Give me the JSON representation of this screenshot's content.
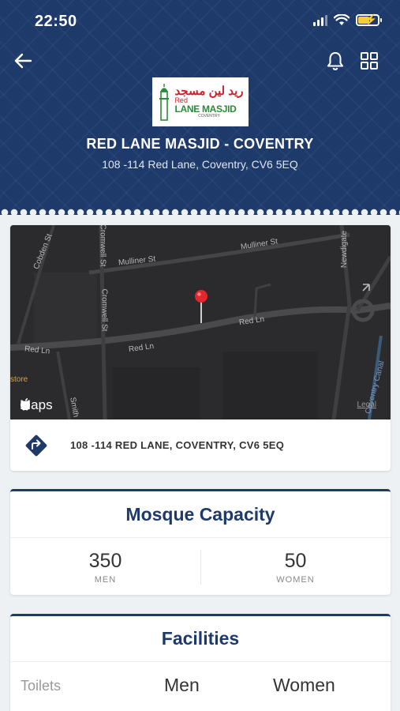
{
  "status_bar": {
    "time": "22:50"
  },
  "header": {
    "logo": {
      "arabic": "ريد لين مسجد",
      "line1": "Red",
      "line2": "LANE MASJID",
      "line3": "COVENTRY"
    },
    "title": "RED LANE MASJID - COVENTRY",
    "address": "108 -114 Red Lane, Coventry, CV6 5EQ"
  },
  "map": {
    "streets": [
      "Mulliner St",
      "Mulliner St",
      "Cromwell St",
      "Cromwell St",
      "Cobden St",
      "Newdigate",
      "Red Ln",
      "Red Ln",
      "Red Ln",
      "Smith",
      "Coventry Canal"
    ],
    "store_label": "store",
    "brand": "Maps",
    "legal": "Legal"
  },
  "directions": {
    "address": "108 -114 RED LANE, COVENTRY, CV6 5EQ"
  },
  "capacity": {
    "title": "Mosque Capacity",
    "men_count": "350",
    "men_label": "MEN",
    "women_count": "50",
    "women_label": "WOMEN"
  },
  "facilities": {
    "title": "Facilities",
    "row_label": "Toilets",
    "col_men": "Men",
    "col_women": "Women"
  },
  "colors": {
    "primary": "#1e3a6b",
    "pin": "#e0282e",
    "map_bg": "#2b2b2d"
  },
  "icons": [
    "back-arrow-icon",
    "bell-icon",
    "grid-icon",
    "directions-icon",
    "map-pin-icon",
    "apple-icon",
    "wifi-icon",
    "battery-icon",
    "signal-icon"
  ]
}
